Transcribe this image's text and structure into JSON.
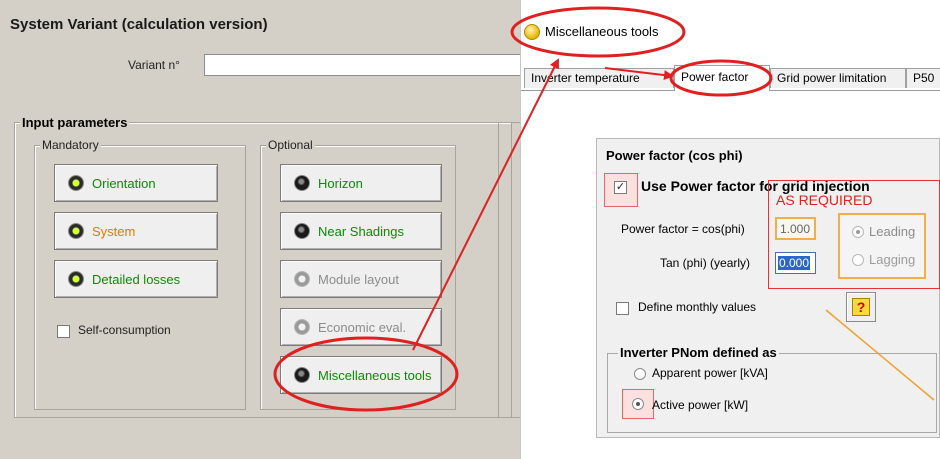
{
  "left": {
    "title": "System Variant (calculation version)",
    "variant_label": "Variant n°",
    "variant_value": "",
    "input_params_title": "Input parameters",
    "mandatory_title": "Mandatory",
    "optional_title": "Optional",
    "mandatory_buttons": [
      {
        "label": "Orientation",
        "led": "green",
        "color": "green"
      },
      {
        "label": "System",
        "led": "green",
        "color": "orange"
      },
      {
        "label": "Detailed losses",
        "led": "green",
        "color": "green"
      }
    ],
    "optional_buttons": [
      {
        "label": "Horizon",
        "led": "dark",
        "color": "green"
      },
      {
        "label": "Near Shadings",
        "led": "dark",
        "color": "green"
      },
      {
        "label": "Module layout",
        "led": "grey",
        "color": "grey"
      },
      {
        "label": "Economic eval.",
        "led": "grey",
        "color": "grey"
      },
      {
        "label": "Miscellaneous tools",
        "led": "dark",
        "color": "green"
      }
    ],
    "self_consumption_label": "Self-consumption"
  },
  "right": {
    "title": "Miscellaneous tools",
    "tabs": [
      "Inverter temperature",
      "Power factor",
      "Grid power limitation",
      "P50"
    ],
    "power_factor": {
      "group_title": "Power factor (cos phi)",
      "use_label": "Use Power factor for grid injection",
      "use_checked": "✓",
      "annotation": "AS REQUIRED",
      "cos_label": "Power factor = cos(phi)",
      "cos_value": "1.000",
      "tan_label": "Tan (phi)  (yearly)",
      "tan_value": "0.000",
      "leading_label": "Leading",
      "lagging_label": "Lagging",
      "monthly_label": "Define monthly values",
      "help_glyph": "?"
    },
    "pnom": {
      "group_title": "Inverter PNom  defined as",
      "apparent_label": "Apparent power  [kVA]",
      "active_label": "Active power  [kW]"
    }
  },
  "colors": {
    "annotation_red": "#e02020",
    "highlight_orange": "#f2ae4a",
    "pointer_line": "#f0a030",
    "green_label": "#0a8c0a",
    "orange_label": "#e07b00"
  }
}
